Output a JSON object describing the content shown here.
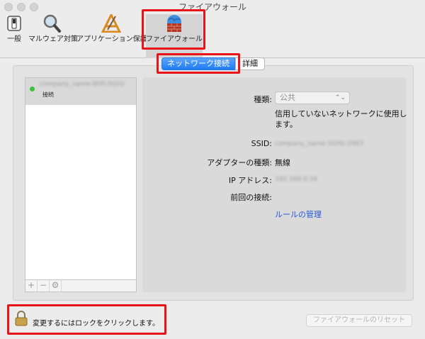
{
  "window": {
    "title": "ファイアウォール"
  },
  "toolbar": {
    "items": [
      {
        "label": "一般"
      },
      {
        "label": "マルウェア対策"
      },
      {
        "label": "アプリケーション保護"
      },
      {
        "label": "ファイアウォール"
      }
    ]
  },
  "tabs": {
    "active": "ネットワーク接続",
    "inactive": "詳細"
  },
  "network_list": {
    "item_name": "company_name-WiFi-5GHz",
    "item_status": "接続",
    "add_label": "+",
    "remove_label": "−",
    "gear_label": "⚙"
  },
  "details": {
    "kind_label": "種類:",
    "kind_value": "公共",
    "kind_arrows": "⌃⌄",
    "description": "信用していないネットワークに使用します。",
    "ssid_label": "SSID:",
    "ssid_value": "company_name-5GHz-2983",
    "adapter_label": "アダプターの種類:",
    "adapter_value": "無線",
    "ip_label": "IP アドレス:",
    "ip_value": "192.168.0.34",
    "last_label": "前回の接続:",
    "rules_link": "ルールの管理"
  },
  "footer": {
    "lock_text": "変更するにはロックをクリックします。",
    "reset_label": "ファイアウォールのリセット"
  },
  "colors": {
    "accent": "#1f7bf2",
    "highlight": "#e8141a",
    "link": "#2558d6",
    "status_online": "#3cc23c"
  }
}
